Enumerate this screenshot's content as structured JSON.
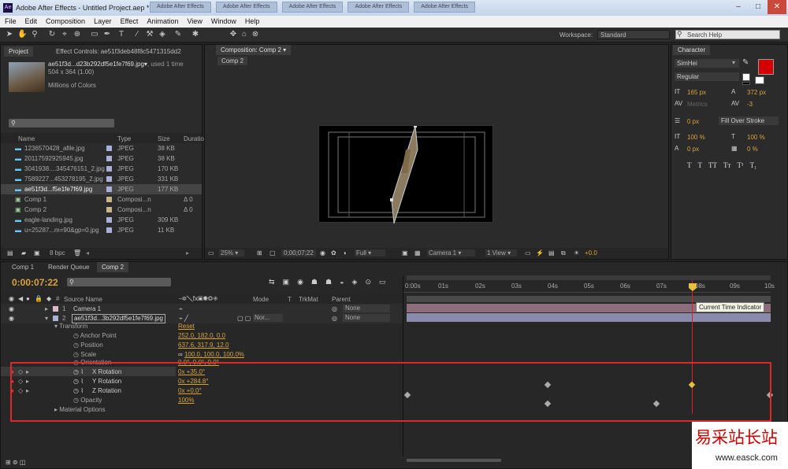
{
  "window": {
    "title": "Adobe After Effects - Untitled Project.aep *",
    "logo": "Ae",
    "min": "–",
    "max": "□",
    "close": "✕",
    "bg_tabs": [
      "Adobe After Effects",
      "Adobe After Effects",
      "Adobe After Effects",
      "Adobe After Effects",
      "Adobe After Effects"
    ]
  },
  "menu": [
    "File",
    "Edit",
    "Composition",
    "Layer",
    "Effect",
    "Animation",
    "View",
    "Window",
    "Help"
  ],
  "toolbar": {
    "workspace_label": "Workspace:",
    "workspace_value": "Standard",
    "search_placeholder": "Search Help"
  },
  "project": {
    "tab": "Project",
    "effect_tab": "Effect Controls: ae51f3deb48f8c5471315dd2",
    "file_name": "ae51f3d...d23b292df5e1fe7f69.jpg▾",
    "used": ", used 1 time",
    "dims": "504 x 364 (1.00)",
    "colors": "Millions of Colors",
    "columns": [
      "Name",
      "Type",
      "Size",
      "Duration"
    ],
    "items": [
      {
        "name": "1236570428_afile.jpg",
        "type": "JPEG",
        "size": "38 KB",
        "dur": ""
      },
      {
        "name": "20117592925945.jpg",
        "type": "JPEG",
        "size": "38 KB",
        "dur": ""
      },
      {
        "name": "3041938....345476151_2.jpg",
        "type": "JPEG",
        "size": "170 KB",
        "dur": ""
      },
      {
        "name": "7589227...453278195_2.jpg",
        "type": "JPEG",
        "size": "331 KB",
        "dur": ""
      },
      {
        "name": "ae51f3d...f5e1fe7f69.jpg",
        "type": "JPEG",
        "size": "177 KB",
        "dur": ""
      },
      {
        "name": "Comp 1",
        "type": "Composi...n",
        "size": "",
        "dur": "Δ 0"
      },
      {
        "name": "Comp 2",
        "type": "Composi...n",
        "size": "",
        "dur": "Δ 0"
      },
      {
        "name": "eagle-landing.jpg",
        "type": "JPEG",
        "size": "309 KB",
        "dur": ""
      },
      {
        "name": "u=25287...m=90&gp=0.jpg",
        "type": "JPEG",
        "size": "11 KB",
        "dur": ""
      }
    ],
    "bpc": "8 bpc"
  },
  "composition": {
    "tab": "Composition: Comp 2",
    "subtab": "Comp 2",
    "zoom": "25%",
    "timecode": "0;00;07;22",
    "res": "Full",
    "camera": "Camera 1",
    "view": "1 View",
    "exposure": "+0.0"
  },
  "character": {
    "tab": "Character",
    "font": "SimHei",
    "style": "Regular",
    "size": "165 px",
    "leading": "372 px",
    "kerning": "Metrics",
    "tracking": "-3",
    "stroke_w": "0 px",
    "stroke_type": "Fill Over Stroke",
    "vscale": "100 %",
    "hscale": "100 %",
    "baseline": "0 px",
    "tsume": "0 %",
    "colors": {
      "fill": "#d40000",
      "stroke": "#ffffff"
    },
    "styles": [
      "T",
      "T",
      "TT",
      "Tт",
      "T¹",
      "T₁"
    ]
  },
  "timeline": {
    "tabs": [
      "Comp 1",
      "Render Queue",
      "Comp 2"
    ],
    "timecode": "0:00:07:22",
    "ruler": [
      "0:00s",
      "01s",
      "02s",
      "03s",
      "04s",
      "05s",
      "06s",
      "07s",
      "08s",
      "09s",
      "10s"
    ],
    "columns": [
      "Source Name",
      "Mode",
      "T",
      "TrkMat",
      "Parent"
    ],
    "layers": [
      {
        "num": "1",
        "name": "Camera 1",
        "parent": "None"
      },
      {
        "num": "2",
        "name": "ae51f3d...3b292df5e1fe7f69.jpg",
        "mode": "Nor...",
        "parent": "None"
      }
    ],
    "transform_label": "Transform",
    "reset": "Reset",
    "props": [
      {
        "name": "Anchor Point",
        "value": "252.0, 182.0, 0.0"
      },
      {
        "name": "Position",
        "value": "637.6, 317.9, 12.0"
      },
      {
        "name": "Scale",
        "value": "100.0, 100.0, 100.0%"
      },
      {
        "name": "Orientation",
        "value": "0.0°, 0.0°, 0.0°"
      },
      {
        "name": "X Rotation",
        "value": "0x +35.0°"
      },
      {
        "name": "Y Rotation",
        "value": "0x +284.8°"
      },
      {
        "name": "Z Rotation",
        "value": "0x +0.0°"
      },
      {
        "name": "Opacity",
        "value": "100%"
      }
    ],
    "material": "Material Options",
    "tooltip": "Current Time Indicator"
  },
  "watermark": {
    "cn": "易采站长站",
    "url": "www.easck.com"
  }
}
